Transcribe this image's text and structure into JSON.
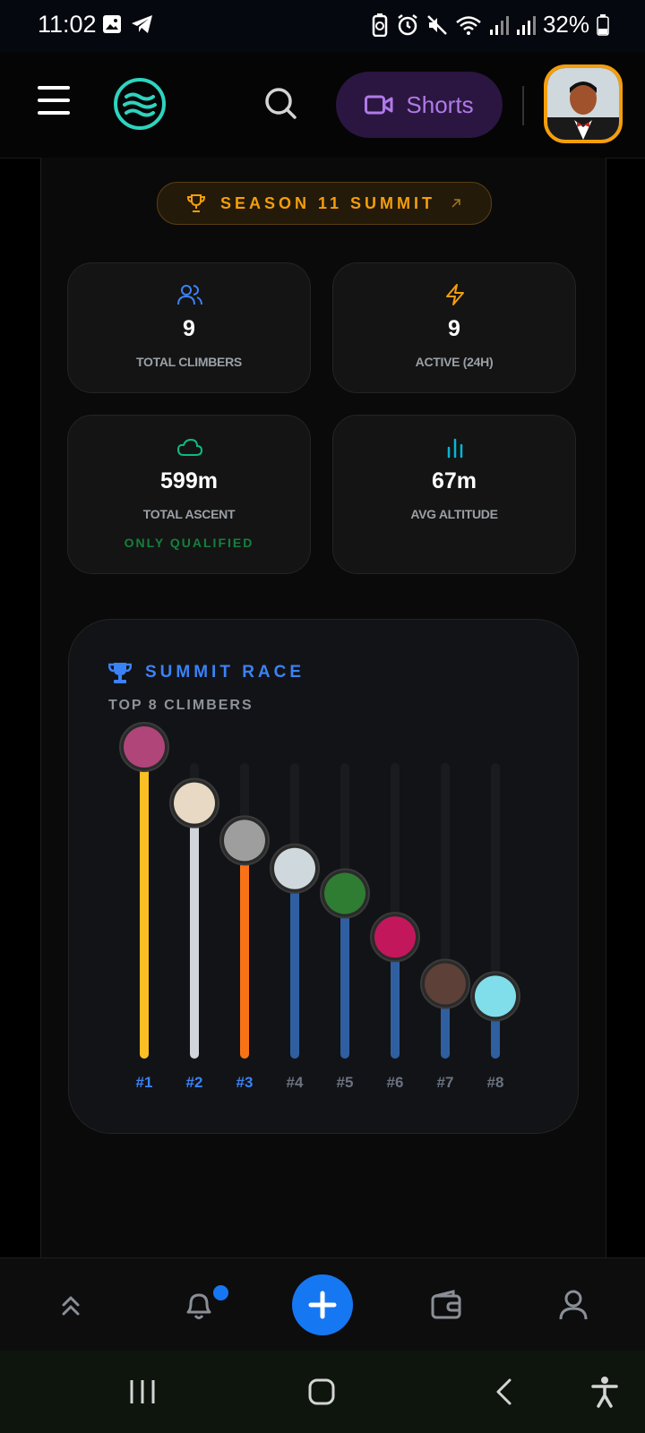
{
  "status_bar": {
    "time": "11:02",
    "battery": "32%"
  },
  "header": {
    "shorts_label": "Shorts"
  },
  "season_banner": {
    "label": "SEASON 11 SUMMIT"
  },
  "stats": [
    {
      "icon": "users-icon",
      "value": "9",
      "label": "TOTAL CLIMBERS",
      "color": "#3b82f6"
    },
    {
      "icon": "lightning-icon",
      "value": "9",
      "label": "ACTIVE (24H)",
      "color": "#f59e0b"
    },
    {
      "icon": "cloud-icon",
      "value": "599m",
      "label": "TOTAL ASCENT",
      "sub": "ONLY QUALIFIED",
      "color": "#10b981"
    },
    {
      "icon": "bar-chart-icon",
      "value": "67m",
      "label": "AVG ALTITUDE",
      "color": "#06b6d4"
    }
  ],
  "summit_race": {
    "title": "SUMMIT RACE",
    "subtitle": "TOP 8 CLIMBERS",
    "ranks": [
      "#1",
      "#2",
      "#3",
      "#4",
      "#5",
      "#6",
      "#7",
      "#8"
    ],
    "progress": [
      1.0,
      0.82,
      0.7,
      0.61,
      0.53,
      0.39,
      0.24,
      0.2
    ],
    "colors": [
      "#fbbf24",
      "#d1d5db",
      "#f97316",
      "#2f5fa0",
      "#2f5fa0",
      "#2f5fa0",
      "#2f5fa0",
      "#2f5fa0"
    ],
    "rank_colors": [
      "#3b82f6",
      "#3b82f6",
      "#3b82f6",
      "#6b7280",
      "#6b7280",
      "#6b7280",
      "#6b7280",
      "#6b7280"
    ]
  },
  "bottom_nav": {
    "items": [
      "chevrons-up-icon",
      "bell-icon",
      "plus-icon",
      "wallet-icon",
      "user-icon"
    ]
  }
}
